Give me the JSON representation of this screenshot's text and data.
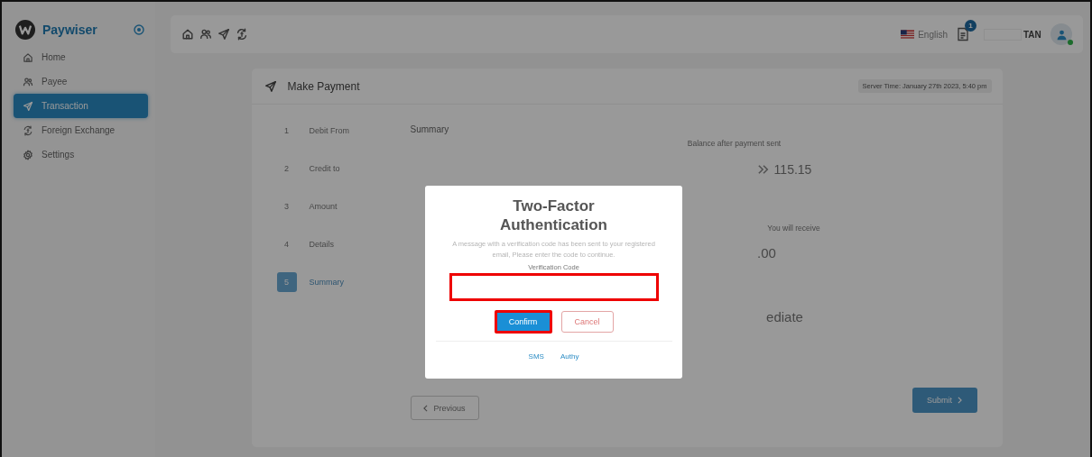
{
  "sidebar": {
    "brand": "Paywiser",
    "items": [
      {
        "label": "Home",
        "selected": false
      },
      {
        "label": "Payee",
        "selected": false
      },
      {
        "label": "Transaction",
        "selected": true
      },
      {
        "label": "Foreign Exchange",
        "selected": false
      },
      {
        "label": "Settings",
        "selected": false
      }
    ]
  },
  "topbar": {
    "language": "English",
    "notification_count": "1",
    "user_name": "TAN",
    "online": true
  },
  "card": {
    "title": "Make Payment",
    "server_time": "Server Time: January 27th 2023, 5:40 pm",
    "steps": [
      {
        "number": "1",
        "label": "Debit From",
        "selected": false
      },
      {
        "number": "2",
        "label": "Credit to",
        "selected": false
      },
      {
        "number": "3",
        "label": "Amount",
        "selected": false
      },
      {
        "number": "4",
        "label": "Details",
        "selected": false
      },
      {
        "number": "5",
        "label": "Summary",
        "selected": true
      }
    ],
    "summary_title": "Summary",
    "balance_label": "Balance after payment sent",
    "balance_value": "115.15",
    "receive_label": "You will receive",
    "receive_value": ".00",
    "execution_value": "ediate",
    "previous_button": "Previous",
    "submit_button": "Submit"
  },
  "dialog": {
    "title": "Two-Factor Authentication",
    "message": "A message with a verification code has been sent to your registered email, Please enter the code to continue.",
    "field_label": "Verification Code",
    "field_highlighted": true,
    "confirm": {
      "label": "Confirm",
      "highlighted": true
    },
    "cancel": "Cancel",
    "methods": [
      {
        "label": "SMS"
      },
      {
        "label": "Authy"
      }
    ]
  }
}
